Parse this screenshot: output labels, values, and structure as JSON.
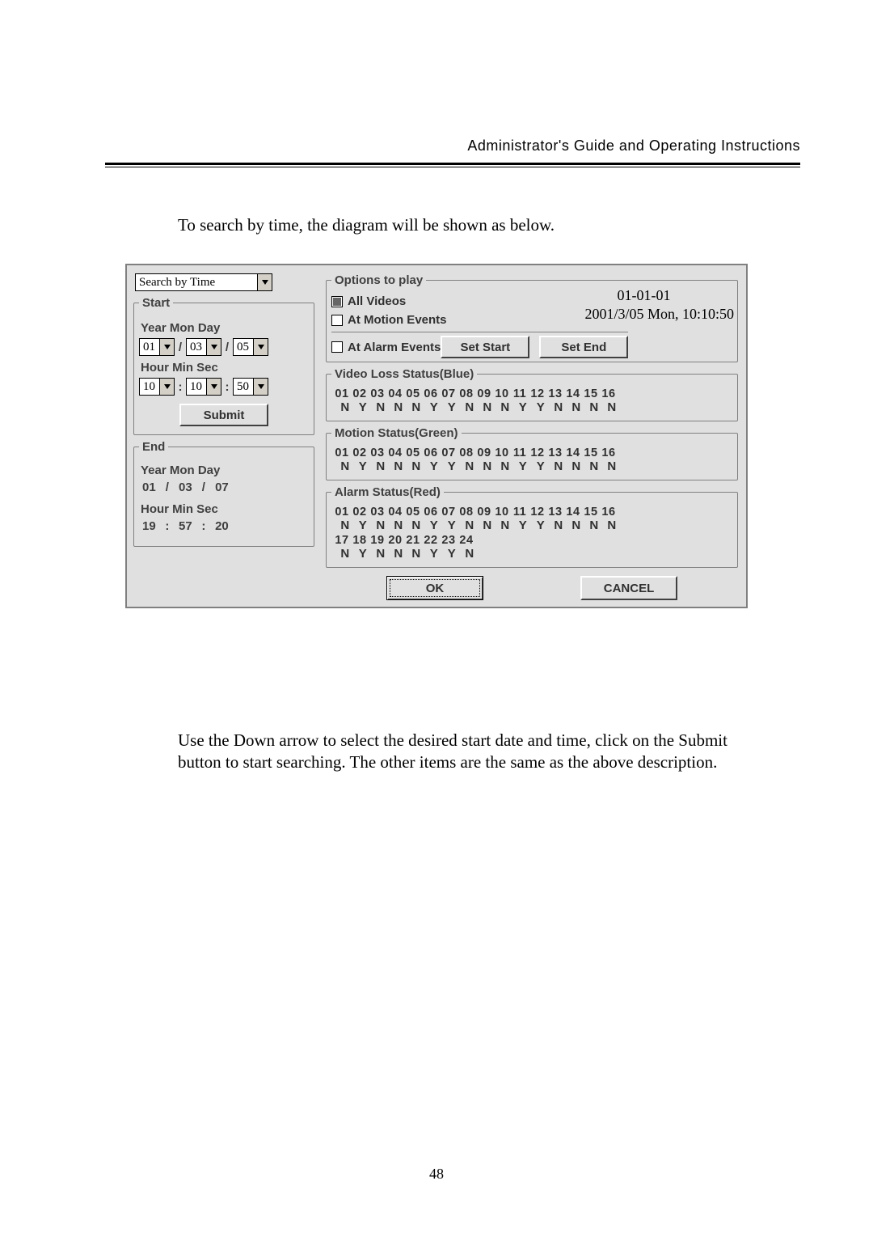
{
  "header": "Administrator's Guide and Operating Instructions",
  "intro": "To search by time, the diagram will be shown as below.",
  "combo_mode": "Search by Time",
  "start": {
    "legend": "Start",
    "ymd_label": "Year Mon Day",
    "year": "01",
    "mon": "03",
    "day": "05",
    "hms_label": "Hour Min Sec",
    "hour": "10",
    "min": "10",
    "sec": "50",
    "submit": "Submit",
    "sep_date": "/",
    "sep_time": ":"
  },
  "end": {
    "legend": "End",
    "ymd_label": "Year Mon Day",
    "year": "01",
    "mon": "03",
    "day": "07",
    "hms_label": "Hour Min Sec",
    "hour": "19",
    "min": "57",
    "sec": "20",
    "sep_date": "/",
    "sep_time": ":"
  },
  "options": {
    "legend": "Options to play",
    "all_videos": "All Videos",
    "motion_events": "At Motion Events",
    "alarm_events": "At Alarm Events",
    "date1": "01-01-01",
    "date2": "2001/3/05   Mon, 10:10:50",
    "set_start": "Set Start",
    "set_end": "Set End"
  },
  "video_loss": {
    "legend": "Video Loss Status(Blue)",
    "nums": [
      "01",
      "02",
      "03",
      "04",
      "05",
      "06",
      "07",
      "08",
      "09",
      "10",
      "11",
      "12",
      "13",
      "14",
      "15",
      "16"
    ],
    "flags": [
      "N",
      "Y",
      "N",
      "N",
      "N",
      "Y",
      "Y",
      "N",
      "N",
      "N",
      "Y",
      "Y",
      "N",
      "N",
      "N",
      "N"
    ]
  },
  "motion": {
    "legend": "Motion Status(Green)",
    "nums": [
      "01",
      "02",
      "03",
      "04",
      "05",
      "06",
      "07",
      "08",
      "09",
      "10",
      "11",
      "12",
      "13",
      "14",
      "15",
      "16"
    ],
    "flags": [
      "N",
      "Y",
      "N",
      "N",
      "N",
      "Y",
      "Y",
      "N",
      "N",
      "N",
      "Y",
      "Y",
      "N",
      "N",
      "N",
      "N"
    ]
  },
  "alarm": {
    "legend": "Alarm Status(Red)",
    "nums1": [
      "01",
      "02",
      "03",
      "04",
      "05",
      "06",
      "07",
      "08",
      "09",
      "10",
      "11",
      "12",
      "13",
      "14",
      "15",
      "16"
    ],
    "flags1": [
      "N",
      "Y",
      "N",
      "N",
      "N",
      "Y",
      "Y",
      "N",
      "N",
      "N",
      "Y",
      "Y",
      "N",
      "N",
      "N",
      "N"
    ],
    "nums2": [
      "17",
      "18",
      "19",
      "20",
      "21",
      "22",
      "23",
      "24"
    ],
    "flags2": [
      "N",
      "Y",
      "N",
      "N",
      "N",
      "Y",
      "Y",
      "N"
    ]
  },
  "buttons": {
    "ok": "OK",
    "cancel": "CANCEL"
  },
  "paragraph": "Use the Down arrow to select the desired start date and time, click on the Submit button to start searching. The other items are the same as the above description.",
  "page_number": "48"
}
